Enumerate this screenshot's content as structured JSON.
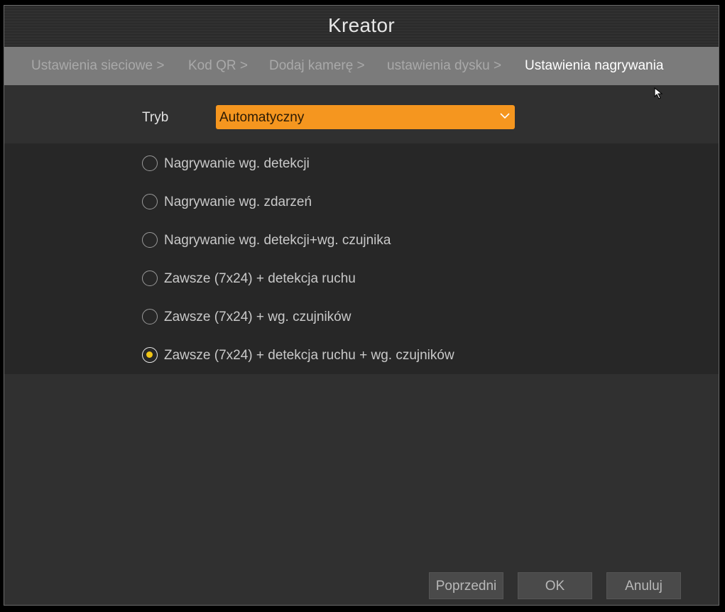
{
  "window": {
    "title": "Kreator"
  },
  "breadcrumb": {
    "items": [
      {
        "label": "Ustawienia sieciowe >",
        "active": false
      },
      {
        "label": "Kod QR >",
        "active": false
      },
      {
        "label": "Dodaj kamerę >",
        "active": false
      },
      {
        "label": "ustawienia dysku >",
        "active": false
      },
      {
        "label": "Ustawienia nagrywania",
        "active": true
      }
    ]
  },
  "mode": {
    "label": "Tryb",
    "selected": "Automatyczny"
  },
  "options": [
    {
      "label": "Nagrywanie wg. detekcji",
      "checked": false
    },
    {
      "label": "Nagrywanie wg. zdarzeń",
      "checked": false
    },
    {
      "label": "Nagrywanie wg. detekcji+wg. czujnika",
      "checked": false
    },
    {
      "label": "Zawsze (7x24) + detekcja ruchu",
      "checked": false
    },
    {
      "label": "Zawsze (7x24) + wg. czujników",
      "checked": false
    },
    {
      "label": "Zawsze (7x24) + detekcja ruchu + wg. czujników",
      "checked": true
    }
  ],
  "buttons": {
    "previous": "Poprzedni",
    "ok": "OK",
    "cancel": "Anuluj"
  },
  "colors": {
    "accent": "#f5961f",
    "radio_selected": "#f1c515"
  }
}
